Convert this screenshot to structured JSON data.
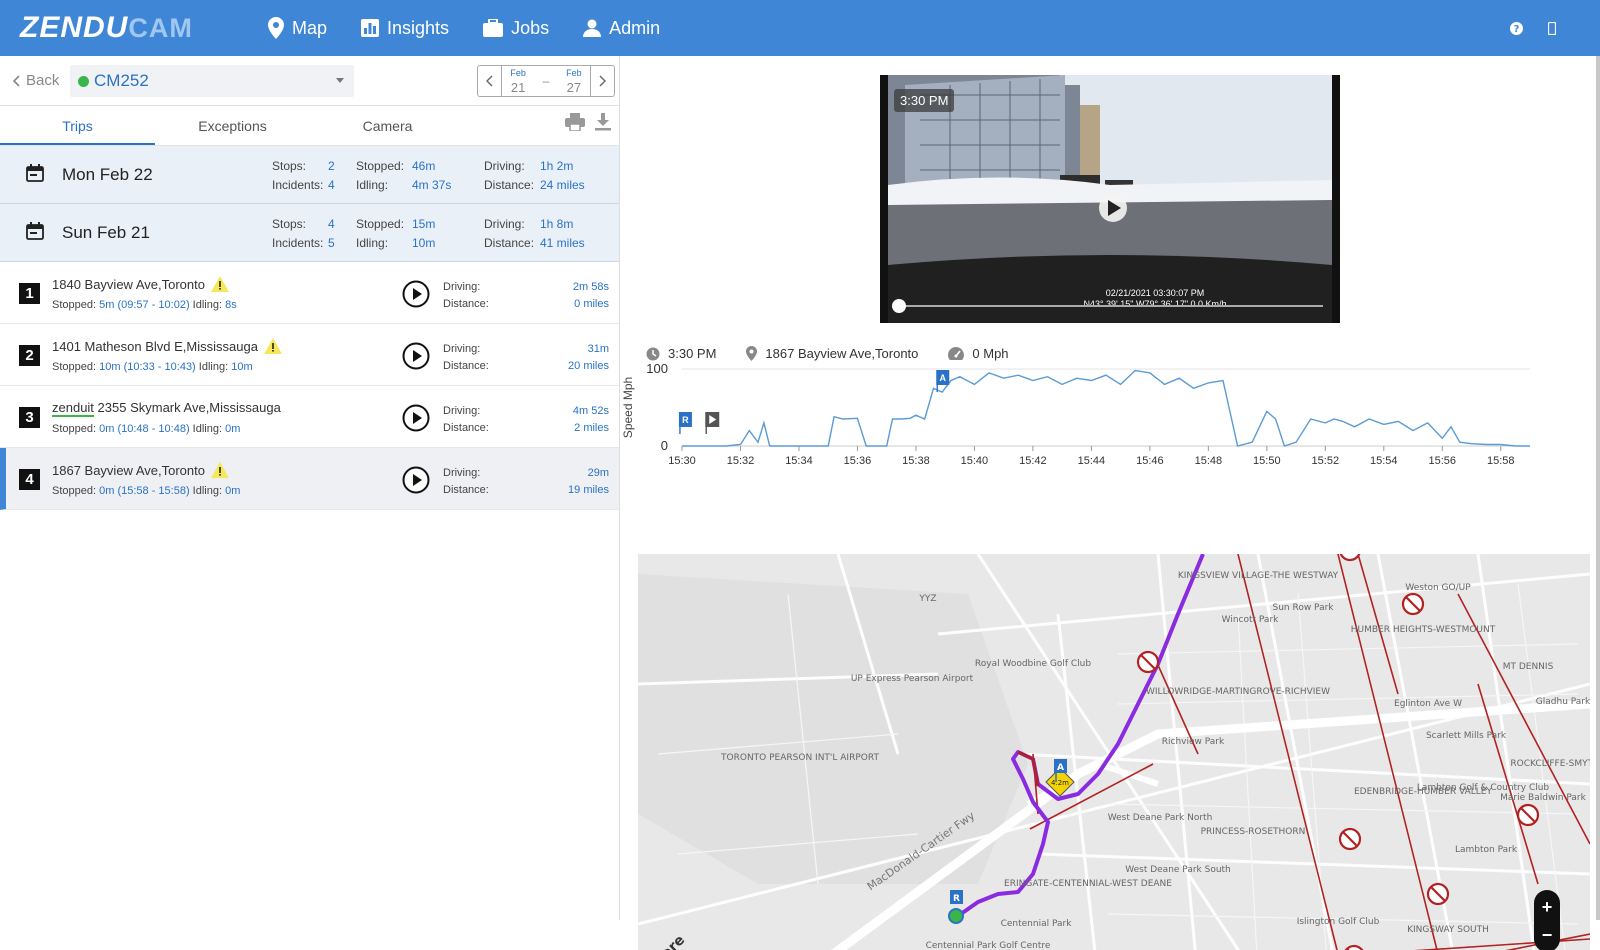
{
  "brand": {
    "part1": "ZENDU",
    "part2": "CAM"
  },
  "nav": [
    {
      "label": "Map",
      "icon": "map-pin-icon"
    },
    {
      "label": "Insights",
      "icon": "chart-icon"
    },
    {
      "label": "Jobs",
      "icon": "briefcase-icon"
    },
    {
      "label": "Admin",
      "icon": "user-icon"
    }
  ],
  "toolbar": {
    "back_label": "Back",
    "vehicle_name": "CM252",
    "vehicle_status_color": "#3ab54a",
    "date_from_month": "Feb",
    "date_from_day": "21",
    "date_sep": "–",
    "date_to_month": "Feb",
    "date_to_day": "27"
  },
  "tabs": [
    "Trips",
    "Exceptions",
    "Camera"
  ],
  "days": [
    {
      "title": "Mon Feb 22",
      "stops_label": "Stops:",
      "stops": "2",
      "incidents_label": "Incidents:",
      "incidents": "4",
      "stopped_label": "Stopped:",
      "stopped": "46m",
      "idling_label": "Idling:",
      "idling": "4m 37s",
      "driving_label": "Driving:",
      "driving": "1h 2m",
      "distance_label": "Distance:",
      "distance": "24 miles"
    },
    {
      "title": "Sun Feb 21",
      "stops_label": "Stops:",
      "stops": "4",
      "incidents_label": "Incidents:",
      "incidents": "5",
      "stopped_label": "Stopped:",
      "stopped": "15m",
      "idling_label": "Idling:",
      "idling": "10m",
      "driving_label": "Driving:",
      "driving": "1h 8m",
      "distance_label": "Distance:",
      "distance": "41 miles"
    }
  ],
  "trips": [
    {
      "num": "1",
      "address": "1840 Bayview Ave,Toronto",
      "stopped_label": "Stopped:",
      "stopped": "5m (09:57 - 10:02)",
      "idling_label": "Idling:",
      "idling": "8s",
      "driving_label": "Driving:",
      "driving": "2m 58s",
      "distance_label": "Distance:",
      "distance": "0 miles"
    },
    {
      "num": "2",
      "address": "1401 Matheson Blvd E,Mississauga",
      "stopped_label": "Stopped:",
      "stopped": "10m (10:33 - 10:43)",
      "idling_label": "Idling:",
      "idling": "10m",
      "driving_label": "Driving:",
      "driving": "31m",
      "distance_label": "Distance:",
      "distance": "20 miles"
    },
    {
      "num": "3",
      "prefix": "zenduit",
      "address": "2355 Skymark Ave,Mississauga",
      "stopped_label": "Stopped:",
      "stopped": "0m (10:48 - 10:48)",
      "idling_label": "Idling:",
      "idling": "0m",
      "driving_label": "Driving:",
      "driving": "4m 52s",
      "distance_label": "Distance:",
      "distance": "2 miles"
    },
    {
      "num": "4",
      "address": "1867 Bayview Ave,Toronto",
      "stopped_label": "Stopped:",
      "stopped": "0m (15:58 - 15:58)",
      "idling_label": "Idling:",
      "idling": "0m",
      "driving_label": "Driving:",
      "driving": "29m",
      "distance_label": "Distance:",
      "distance": "19 miles"
    }
  ],
  "video": {
    "badge": "3:30 PM",
    "timestamp": "02/21/2021 03:30:07 PM",
    "coords": "N43° 39' 15\" W79° 36' 17\" 0.0 Km/h"
  },
  "info": {
    "time": "3:30 PM",
    "address": "1867 Bayview Ave,Toronto",
    "speed": "0 Mph"
  },
  "chart_data": {
    "type": "line",
    "ylabel": "Speed Mph",
    "ylim": [
      0,
      100
    ],
    "yticks": [
      "100",
      "0"
    ],
    "xticks": [
      "15:30",
      "15:32",
      "15:34",
      "15:36",
      "15:38",
      "15:40",
      "15:42",
      "15:44",
      "15:46",
      "15:48",
      "15:50",
      "15:52",
      "15:54",
      "15:56",
      "15:58"
    ],
    "xlim": [
      0,
      29
    ],
    "grid": "horizontal",
    "markers": [
      {
        "label": "R",
        "x": 0.1
      },
      {
        "label": "A",
        "x": 8.9
      }
    ],
    "series": [
      {
        "color": "#5b9bd5",
        "x": [
          0,
          0.5,
          1,
          1.5,
          2,
          2.3,
          2.6,
          2.8,
          3.0,
          3.2,
          3.5,
          3.8,
          4.0,
          4.5,
          5.0,
          5.2,
          5.5,
          6.0,
          6.3,
          6.6,
          7.0,
          7.2,
          7.5,
          7.8,
          8.0,
          8.3,
          8.6,
          8.9,
          9.2,
          9.5,
          10.0,
          10.5,
          11.0,
          11.5,
          12.0,
          12.5,
          13.0,
          13.5,
          14.0,
          14.5,
          15.0,
          15.5,
          16.0,
          16.5,
          17.0,
          17.5,
          18.0,
          18.5,
          19.0,
          19.5,
          20.0,
          20.3,
          20.6,
          21.0,
          21.5,
          22.0,
          22.3,
          22.6,
          23.0,
          23.5,
          24.0,
          24.5,
          25.0,
          25.5,
          26.0,
          26.3,
          26.6,
          27.0,
          27.5,
          28.0,
          28.5,
          29.0
        ],
        "y": [
          0,
          0,
          0,
          0,
          2,
          20,
          5,
          30,
          0,
          0,
          0,
          0,
          0,
          0,
          0,
          38,
          35,
          36,
          0,
          0,
          0,
          35,
          35,
          36,
          40,
          35,
          75,
          70,
          85,
          90,
          80,
          95,
          88,
          92,
          85,
          90,
          80,
          88,
          85,
          92,
          80,
          98,
          95,
          80,
          88,
          75,
          82,
          85,
          0,
          5,
          45,
          35,
          0,
          5,
          35,
          30,
          35,
          32,
          25,
          35,
          28,
          32,
          20,
          30,
          10,
          25,
          5,
          3,
          2,
          2,
          0,
          0
        ]
      }
    ]
  },
  "map": {
    "labels": [
      "KINGSVIEW VILLAGE-THE WESTWAY",
      "Wincott Park",
      "Sun Row Park",
      "Weston GO/UP",
      "HUMBER HEIGHTS-WESTMOUNT",
      "YYZ",
      "Royal Woodbine Golf Club",
      "UP Express Pearson Airport",
      "WILLOWRIDGE-MARTINGROVE-RICHVIEW",
      "MT DENNIS",
      "Eglinton Ave W",
      "Richview Park",
      "TORONTO PEARSON INT'L AIRPORT",
      "West Deane Park North",
      "PRINCESS-ROSETHORN",
      "EDENBRIDGE-HUMBER VALLEY",
      "Lambton Golf & Country Club",
      "West Deane Park South",
      "ERINGATE-CENTENNIAL-WEST DEANE",
      "Centennial Park",
      "Islington Golf Club",
      "KINGSWAY SOUTH",
      "MacDonald-Cartier Fwy",
      "Centennial Park Golf Centre",
      "Scarlett Mills Park",
      "Lambton Park",
      "Marie Baldwin Park",
      "ROCKCLIFFE-SMYTHE",
      "Gladhu Park",
      "here"
    ],
    "incident": "4.2m",
    "start_marker": "R",
    "a_marker": "A",
    "route_color": "#8a2be2",
    "restriction_color": "#b22222"
  }
}
